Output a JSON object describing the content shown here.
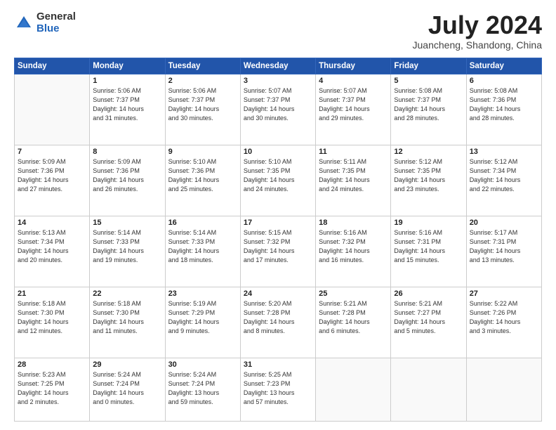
{
  "logo": {
    "general": "General",
    "blue": "Blue"
  },
  "title": {
    "month_year": "July 2024",
    "location": "Juancheng, Shandong, China"
  },
  "header_days": [
    "Sunday",
    "Monday",
    "Tuesday",
    "Wednesday",
    "Thursday",
    "Friday",
    "Saturday"
  ],
  "weeks": [
    [
      {
        "num": "",
        "info": ""
      },
      {
        "num": "1",
        "info": "Sunrise: 5:06 AM\nSunset: 7:37 PM\nDaylight: 14 hours\nand 31 minutes."
      },
      {
        "num": "2",
        "info": "Sunrise: 5:06 AM\nSunset: 7:37 PM\nDaylight: 14 hours\nand 30 minutes."
      },
      {
        "num": "3",
        "info": "Sunrise: 5:07 AM\nSunset: 7:37 PM\nDaylight: 14 hours\nand 30 minutes."
      },
      {
        "num": "4",
        "info": "Sunrise: 5:07 AM\nSunset: 7:37 PM\nDaylight: 14 hours\nand 29 minutes."
      },
      {
        "num": "5",
        "info": "Sunrise: 5:08 AM\nSunset: 7:37 PM\nDaylight: 14 hours\nand 28 minutes."
      },
      {
        "num": "6",
        "info": "Sunrise: 5:08 AM\nSunset: 7:36 PM\nDaylight: 14 hours\nand 28 minutes."
      }
    ],
    [
      {
        "num": "7",
        "info": "Sunrise: 5:09 AM\nSunset: 7:36 PM\nDaylight: 14 hours\nand 27 minutes."
      },
      {
        "num": "8",
        "info": "Sunrise: 5:09 AM\nSunset: 7:36 PM\nDaylight: 14 hours\nand 26 minutes."
      },
      {
        "num": "9",
        "info": "Sunrise: 5:10 AM\nSunset: 7:36 PM\nDaylight: 14 hours\nand 25 minutes."
      },
      {
        "num": "10",
        "info": "Sunrise: 5:10 AM\nSunset: 7:35 PM\nDaylight: 14 hours\nand 24 minutes."
      },
      {
        "num": "11",
        "info": "Sunrise: 5:11 AM\nSunset: 7:35 PM\nDaylight: 14 hours\nand 24 minutes."
      },
      {
        "num": "12",
        "info": "Sunrise: 5:12 AM\nSunset: 7:35 PM\nDaylight: 14 hours\nand 23 minutes."
      },
      {
        "num": "13",
        "info": "Sunrise: 5:12 AM\nSunset: 7:34 PM\nDaylight: 14 hours\nand 22 minutes."
      }
    ],
    [
      {
        "num": "14",
        "info": "Sunrise: 5:13 AM\nSunset: 7:34 PM\nDaylight: 14 hours\nand 20 minutes."
      },
      {
        "num": "15",
        "info": "Sunrise: 5:14 AM\nSunset: 7:33 PM\nDaylight: 14 hours\nand 19 minutes."
      },
      {
        "num": "16",
        "info": "Sunrise: 5:14 AM\nSunset: 7:33 PM\nDaylight: 14 hours\nand 18 minutes."
      },
      {
        "num": "17",
        "info": "Sunrise: 5:15 AM\nSunset: 7:32 PM\nDaylight: 14 hours\nand 17 minutes."
      },
      {
        "num": "18",
        "info": "Sunrise: 5:16 AM\nSunset: 7:32 PM\nDaylight: 14 hours\nand 16 minutes."
      },
      {
        "num": "19",
        "info": "Sunrise: 5:16 AM\nSunset: 7:31 PM\nDaylight: 14 hours\nand 15 minutes."
      },
      {
        "num": "20",
        "info": "Sunrise: 5:17 AM\nSunset: 7:31 PM\nDaylight: 14 hours\nand 13 minutes."
      }
    ],
    [
      {
        "num": "21",
        "info": "Sunrise: 5:18 AM\nSunset: 7:30 PM\nDaylight: 14 hours\nand 12 minutes."
      },
      {
        "num": "22",
        "info": "Sunrise: 5:18 AM\nSunset: 7:30 PM\nDaylight: 14 hours\nand 11 minutes."
      },
      {
        "num": "23",
        "info": "Sunrise: 5:19 AM\nSunset: 7:29 PM\nDaylight: 14 hours\nand 9 minutes."
      },
      {
        "num": "24",
        "info": "Sunrise: 5:20 AM\nSunset: 7:28 PM\nDaylight: 14 hours\nand 8 minutes."
      },
      {
        "num": "25",
        "info": "Sunrise: 5:21 AM\nSunset: 7:28 PM\nDaylight: 14 hours\nand 6 minutes."
      },
      {
        "num": "26",
        "info": "Sunrise: 5:21 AM\nSunset: 7:27 PM\nDaylight: 14 hours\nand 5 minutes."
      },
      {
        "num": "27",
        "info": "Sunrise: 5:22 AM\nSunset: 7:26 PM\nDaylight: 14 hours\nand 3 minutes."
      }
    ],
    [
      {
        "num": "28",
        "info": "Sunrise: 5:23 AM\nSunset: 7:25 PM\nDaylight: 14 hours\nand 2 minutes."
      },
      {
        "num": "29",
        "info": "Sunrise: 5:24 AM\nSunset: 7:24 PM\nDaylight: 14 hours\nand 0 minutes."
      },
      {
        "num": "30",
        "info": "Sunrise: 5:24 AM\nSunset: 7:24 PM\nDaylight: 13 hours\nand 59 minutes."
      },
      {
        "num": "31",
        "info": "Sunrise: 5:25 AM\nSunset: 7:23 PM\nDaylight: 13 hours\nand 57 minutes."
      },
      {
        "num": "",
        "info": ""
      },
      {
        "num": "",
        "info": ""
      },
      {
        "num": "",
        "info": ""
      }
    ]
  ]
}
